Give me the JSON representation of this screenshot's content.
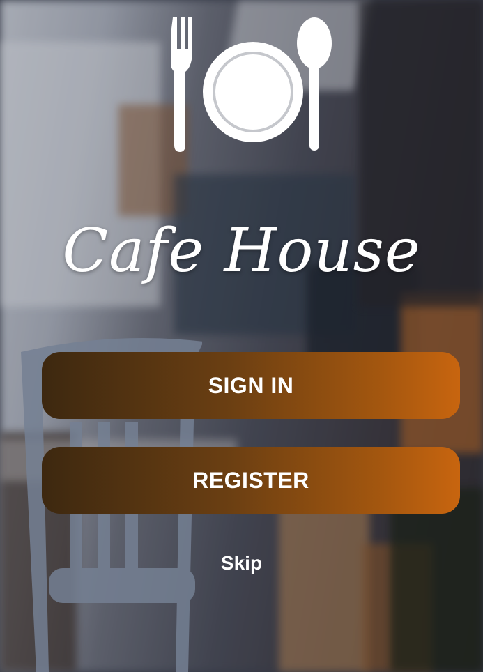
{
  "app": {
    "name": "Cafe House",
    "logo_icon": "fork-plate-spoon-icon"
  },
  "actions": {
    "sign_in_label": "SIGN IN",
    "register_label": "REGISTER",
    "skip_label": "Skip"
  },
  "colors": {
    "button_gradient_start": "#3d2810",
    "button_gradient_end": "#c8650f",
    "text": "#ffffff"
  }
}
